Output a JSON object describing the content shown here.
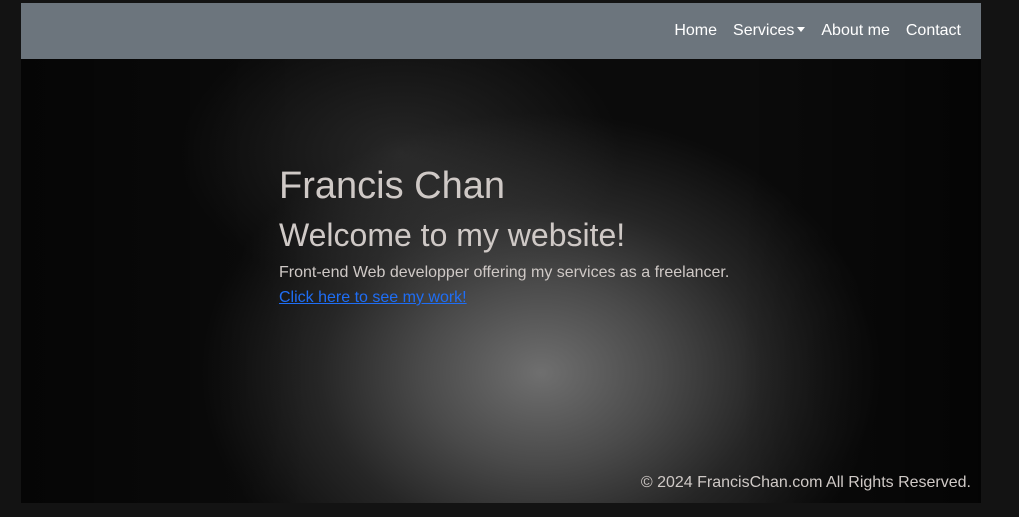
{
  "nav": {
    "items": [
      {
        "label": "Home"
      },
      {
        "label": "Services"
      },
      {
        "label": "About me"
      },
      {
        "label": "Contact"
      }
    ]
  },
  "hero": {
    "name": "Francis Chan",
    "welcome": "Welcome to my website!",
    "tagline": "Front-end Web developper offering my services as a freelancer.",
    "cta_link": "Click here to see my work!"
  },
  "footer": {
    "copyright": "© 2024 FrancisChan.com All Rights Reserved."
  },
  "colors": {
    "navbar_bg": "#6c757d",
    "link": "#1f6ef5",
    "text": "#cfc9c6"
  }
}
